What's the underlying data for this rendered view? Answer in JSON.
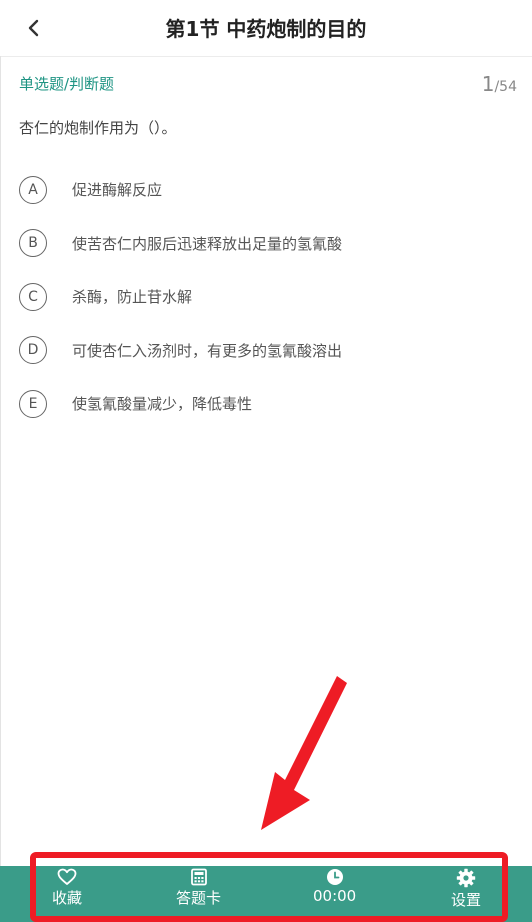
{
  "header": {
    "title": "第1节 中药炮制的目的",
    "back_icon": "chevron-left-icon"
  },
  "question": {
    "type_label": "单选题/判断题",
    "current": "1",
    "total": "/54",
    "stem": "杏仁的炮制作用为（）。",
    "options": [
      {
        "letter": "A",
        "text": "促进酶解反应"
      },
      {
        "letter": "B",
        "text": "使苦杏仁内服后迅速释放出足量的氢氰酸"
      },
      {
        "letter": "C",
        "text": "杀酶，防止苷水解"
      },
      {
        "letter": "D",
        "text": "可使杏仁入汤剂时，有更多的氢氰酸溶出"
      },
      {
        "letter": "E",
        "text": "使氢氰酸量减少，降低毒性"
      }
    ]
  },
  "toolbar": {
    "favorite": {
      "label": "收藏",
      "icon": "heart-icon"
    },
    "answer_card": {
      "label": "答题卡",
      "icon": "card-grid-icon"
    },
    "timer": {
      "label": "00:00",
      "icon": "clock-icon"
    },
    "settings": {
      "label": "设置",
      "icon": "gear-icon"
    }
  },
  "colors": {
    "accent": "#1e9483",
    "toolbar_bg": "#3a9c89",
    "annotation_red": "#ee1c25"
  }
}
